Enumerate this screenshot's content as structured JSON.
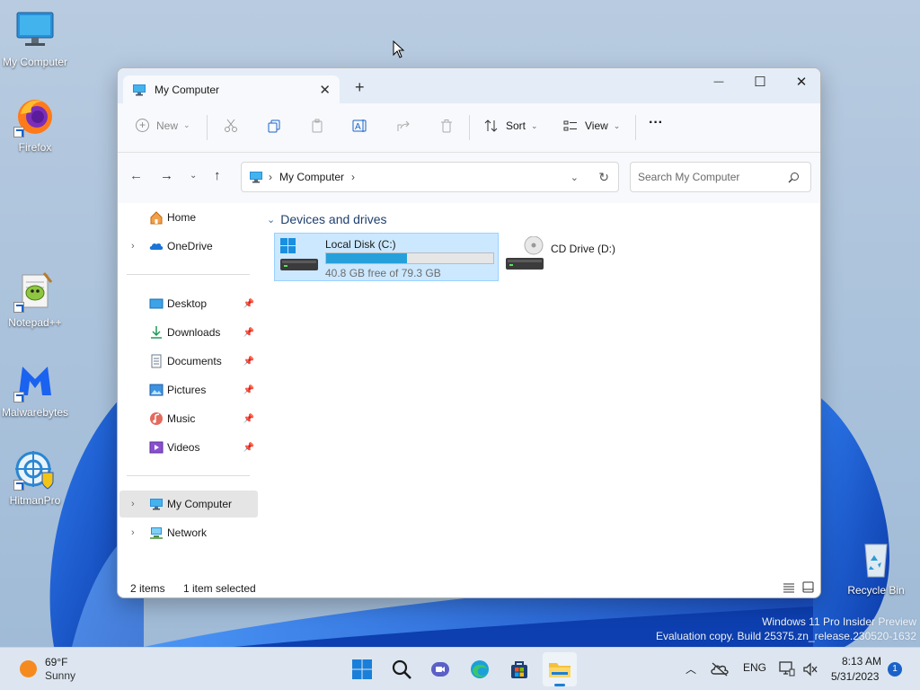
{
  "desktop": {
    "icons": [
      {
        "label": "My Computer",
        "icon": "monitor-icon"
      },
      {
        "label": "Firefox",
        "icon": "firefox-icon"
      },
      {
        "label": "Notepad++",
        "icon": "notepadpp-icon"
      },
      {
        "label": "Malwarebytes",
        "icon": "malwarebytes-icon"
      },
      {
        "label": "HitmanPro",
        "icon": "hitmanpro-icon"
      },
      {
        "label": "Recycle Bin",
        "icon": "recycle-bin-icon"
      }
    ]
  },
  "window": {
    "tab_title": "My Computer",
    "controls": {
      "minimize": "—",
      "maximize": "☐",
      "close": "✕"
    },
    "commandbar": {
      "new_label": "New",
      "sort_label": "Sort",
      "view_label": "View",
      "more_label": "···"
    },
    "address": {
      "path_item": "My Computer",
      "search_placeholder": "Search My Computer"
    },
    "sidebar": {
      "home": "Home",
      "onedrive": "OneDrive",
      "quick_access": [
        {
          "label": "Desktop",
          "icon": "desktop-folder-icon"
        },
        {
          "label": "Downloads",
          "icon": "downloads-icon"
        },
        {
          "label": "Documents",
          "icon": "documents-icon"
        },
        {
          "label": "Pictures",
          "icon": "pictures-icon"
        },
        {
          "label": "Music",
          "icon": "music-icon"
        },
        {
          "label": "Videos",
          "icon": "videos-icon"
        }
      ],
      "my_computer": "My Computer",
      "network": "Network"
    },
    "content": {
      "group_header": "Devices and drives",
      "drives": [
        {
          "name": "Local Disk (C:)",
          "free_text": "40.8 GB free of 79.3 GB",
          "used_fraction": 0.485,
          "selected": true
        },
        {
          "name": "CD Drive (D:)",
          "selected": false
        }
      ]
    },
    "status": {
      "items_count": "2 items",
      "selection": "1 item selected"
    }
  },
  "watermark": {
    "line1": "Windows 11 Pro Insider Preview",
    "line2": "Evaluation copy. Build 25375.zn_release.230520-1632"
  },
  "taskbar": {
    "weather_temp": "69°F",
    "weather_desc": "Sunny",
    "language": "ENG",
    "time": "8:13 AM",
    "date": "5/31/2023",
    "notification_count": "1"
  },
  "colors": {
    "accent": "#26a0da",
    "selection_bg": "#cce8ff",
    "wallpaper_blue": "#1656c9"
  }
}
